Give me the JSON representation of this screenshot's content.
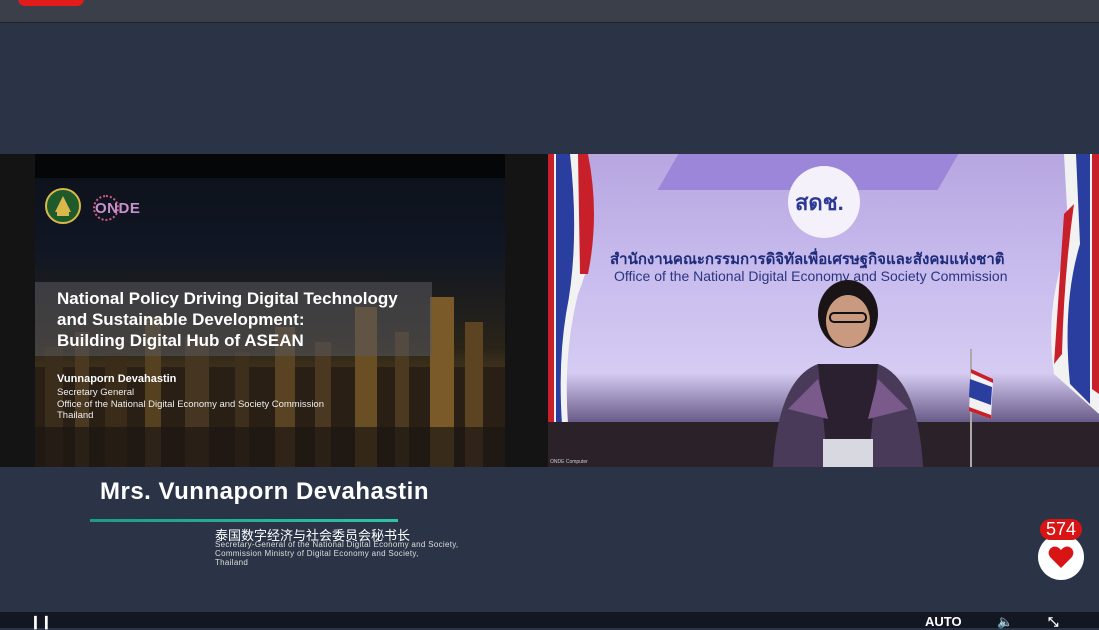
{
  "slide": {
    "logo_text": "ONDE",
    "title_lines": [
      "National Policy Driving Digital Technology",
      "and Sustainable Development:",
      "Building Digital Hub of ASEAN"
    ],
    "presenter_name": "Vunnaporn Devahastin",
    "presenter_role_lines": [
      "Secretary General",
      "Office of the National Digital Economy and Society Commission",
      "Thailand"
    ]
  },
  "camera": {
    "logo_text": "สดช.",
    "thai_org_name": "สำนักงานคณะกรรมการดิจิทัลเพื่อเศรษฐกิจและสังคมแห่งชาติ",
    "english_org_name": "Office of the National Digital Economy and Society Commission",
    "caption": "ONDE Computer"
  },
  "lower_third": {
    "speaker_name": "Mrs. Vunnaporn Devahastin",
    "chinese_title": "泰国数字经济与社会委员会秘书长",
    "english_lines": [
      "Secretary-General of the National Digital Economy and Society,",
      "Commission Ministry of Digital Economy and Society,",
      "Thailand"
    ]
  },
  "likes": {
    "count": "574"
  },
  "controls": {
    "quality_label": "AUTO"
  },
  "colors": {
    "accent_red": "#d81414",
    "underline_teal": "#2ec4a5",
    "background": "#2b3447"
  }
}
